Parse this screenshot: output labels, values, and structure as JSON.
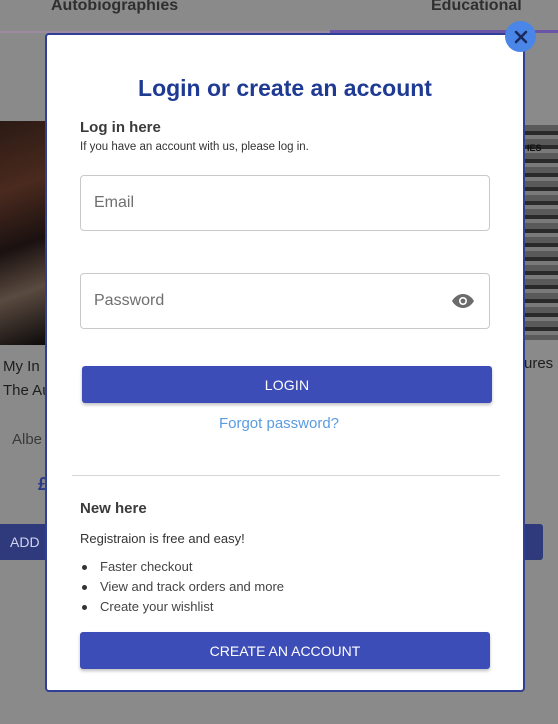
{
  "background": {
    "tabs": [
      "Autobiographies",
      "Educational"
    ],
    "left_book": {
      "title_line1": "My In",
      "title_line2": "The Au",
      "author": "Albe",
      "price": "£",
      "add_label": "ADD"
    },
    "right_book": {
      "cover_label": "IES",
      "title_fragment": "ures"
    }
  },
  "modal": {
    "title": "Login or create an account",
    "login": {
      "heading": "Log in here",
      "subtext": "If you have an account with us, please log in.",
      "email_placeholder": "Email",
      "password_placeholder": "Password",
      "login_label": "LOGIN",
      "forgot_label": "Forgot password?"
    },
    "register": {
      "heading": "New here",
      "subtext": "Registraion is free and easy!",
      "benefits": [
        "Faster checkout",
        "View and track orders and more",
        "Create your wishlist"
      ],
      "create_label": "CREATE AN ACCOUNT"
    }
  },
  "colors": {
    "accent": "#3d4db7",
    "title": "#1f3a93",
    "link": "#5a9be0",
    "close": "#4a86e8"
  },
  "icons": {
    "close": "close-icon",
    "password_toggle": "eye-icon"
  }
}
